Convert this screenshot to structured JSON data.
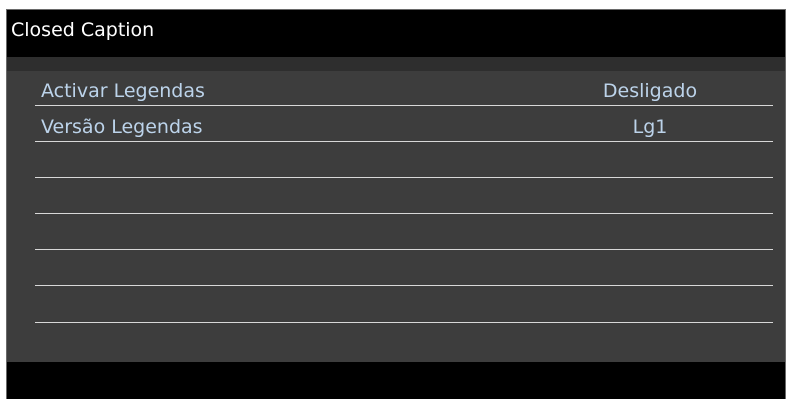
{
  "window": {
    "title": "Closed Caption"
  },
  "menu": {
    "rows": [
      {
        "label": "Activar Legendas",
        "value": "Desligado"
      },
      {
        "label": "Versão Legendas",
        "value": "Lg1"
      },
      {
        "label": "",
        "value": ""
      },
      {
        "label": "",
        "value": ""
      },
      {
        "label": "",
        "value": ""
      },
      {
        "label": "",
        "value": ""
      },
      {
        "label": "",
        "value": ""
      }
    ]
  },
  "colors": {
    "panel_background": "#3d3d3d",
    "title_bar": "#000000",
    "menu_text": "#bcd3ea",
    "row_line": "#d8d8d8"
  }
}
